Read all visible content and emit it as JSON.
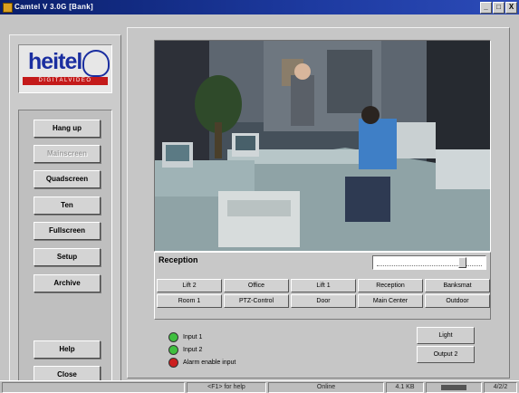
{
  "window": {
    "title": "Camtel  V 3.0G  [Bank]",
    "controls": [
      "_",
      "□",
      "X"
    ]
  },
  "logo": {
    "brand": "heitel",
    "tagline": "DIGITALVIDEO"
  },
  "nav": {
    "items": [
      {
        "label": "Hang up",
        "enabled": true
      },
      {
        "label": "Mainscreen",
        "enabled": false
      },
      {
        "label": "Quadscreen",
        "enabled": true
      },
      {
        "label": "Ten",
        "enabled": true
      },
      {
        "label": "Fullscreen",
        "enabled": true
      },
      {
        "label": "Setup",
        "enabled": true
      },
      {
        "label": "Archive",
        "enabled": true
      }
    ],
    "help_label": "Help",
    "close_label": "Close"
  },
  "camera": {
    "current": "Reception",
    "slider_level": 0.8
  },
  "camera_buttons": {
    "row1": [
      "Lift 2",
      "Office",
      "Lift 1",
      "Reception",
      "Banksmat"
    ],
    "row2": [
      "Room 1",
      "PTZ-Control",
      "Door",
      "Main Center",
      "Outdoor"
    ]
  },
  "inputs": [
    {
      "label": "Input 1",
      "color": "#3fbf3f"
    },
    {
      "label": "Input 2",
      "color": "#3fbf3f"
    },
    {
      "label": "Alarm enable input",
      "color": "#cc1f1f"
    }
  ],
  "outputs": {
    "light_label": "Light",
    "output2_label": "Output 2"
  },
  "status": {
    "help_hint": "<F1> for help",
    "connection": "Online",
    "size": "4.1 KB",
    "counter": "4/2/2"
  }
}
